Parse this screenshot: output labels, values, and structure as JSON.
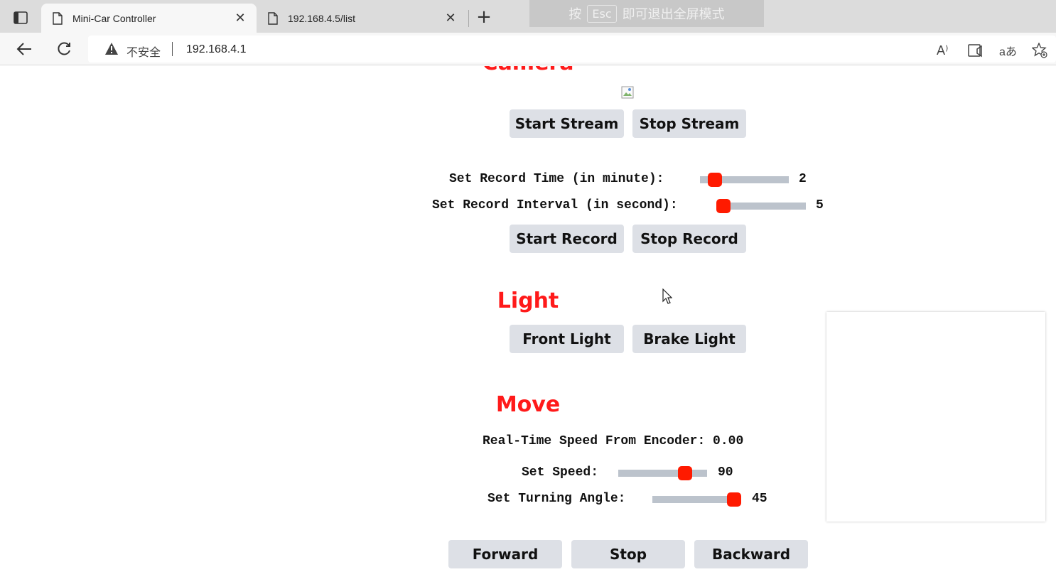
{
  "browser": {
    "tabs": [
      {
        "title": "Mini-Car Controller",
        "active": true
      },
      {
        "title": "192.168.4.5/list",
        "active": false
      }
    ],
    "fullscreen_hint": {
      "prefix": "按",
      "key": "Esc",
      "suffix": "即可退出全屏模式"
    },
    "address": {
      "security_label": "不安全",
      "url": "192.168.4.1"
    },
    "tools": {
      "read_aloud": "A⁾",
      "translate": "aあ"
    }
  },
  "page": {
    "camera": {
      "heading": "Camera",
      "start_stream": "Start Stream",
      "stop_stream": "Stop Stream",
      "record_time": {
        "label": "Set Record Time (in minute):",
        "value": "2",
        "level": 0.1
      },
      "record_interval": {
        "label": "Set Record Interval (in second):",
        "value": "5",
        "level": 0.0
      },
      "start_record": "Start Record",
      "stop_record": "Stop Record"
    },
    "light": {
      "heading": "Light",
      "front_light": "Front Light",
      "brake_light": "Brake Light"
    },
    "move": {
      "heading": "Move",
      "speed_label": "Real-Time Speed From Encoder: 0.00",
      "set_speed": {
        "label": "Set Speed:",
        "value": "90",
        "level": 0.8
      },
      "turning_angle": {
        "label": "Set Turning Angle:",
        "value": "45",
        "level": 1.0
      },
      "forward": "Forward",
      "stop": "Stop",
      "backward": "Backward"
    }
  },
  "colors": {
    "accent": "#ff1a1a",
    "slider_track": "#bcc3cc",
    "button_bg": "#dde0e6"
  }
}
